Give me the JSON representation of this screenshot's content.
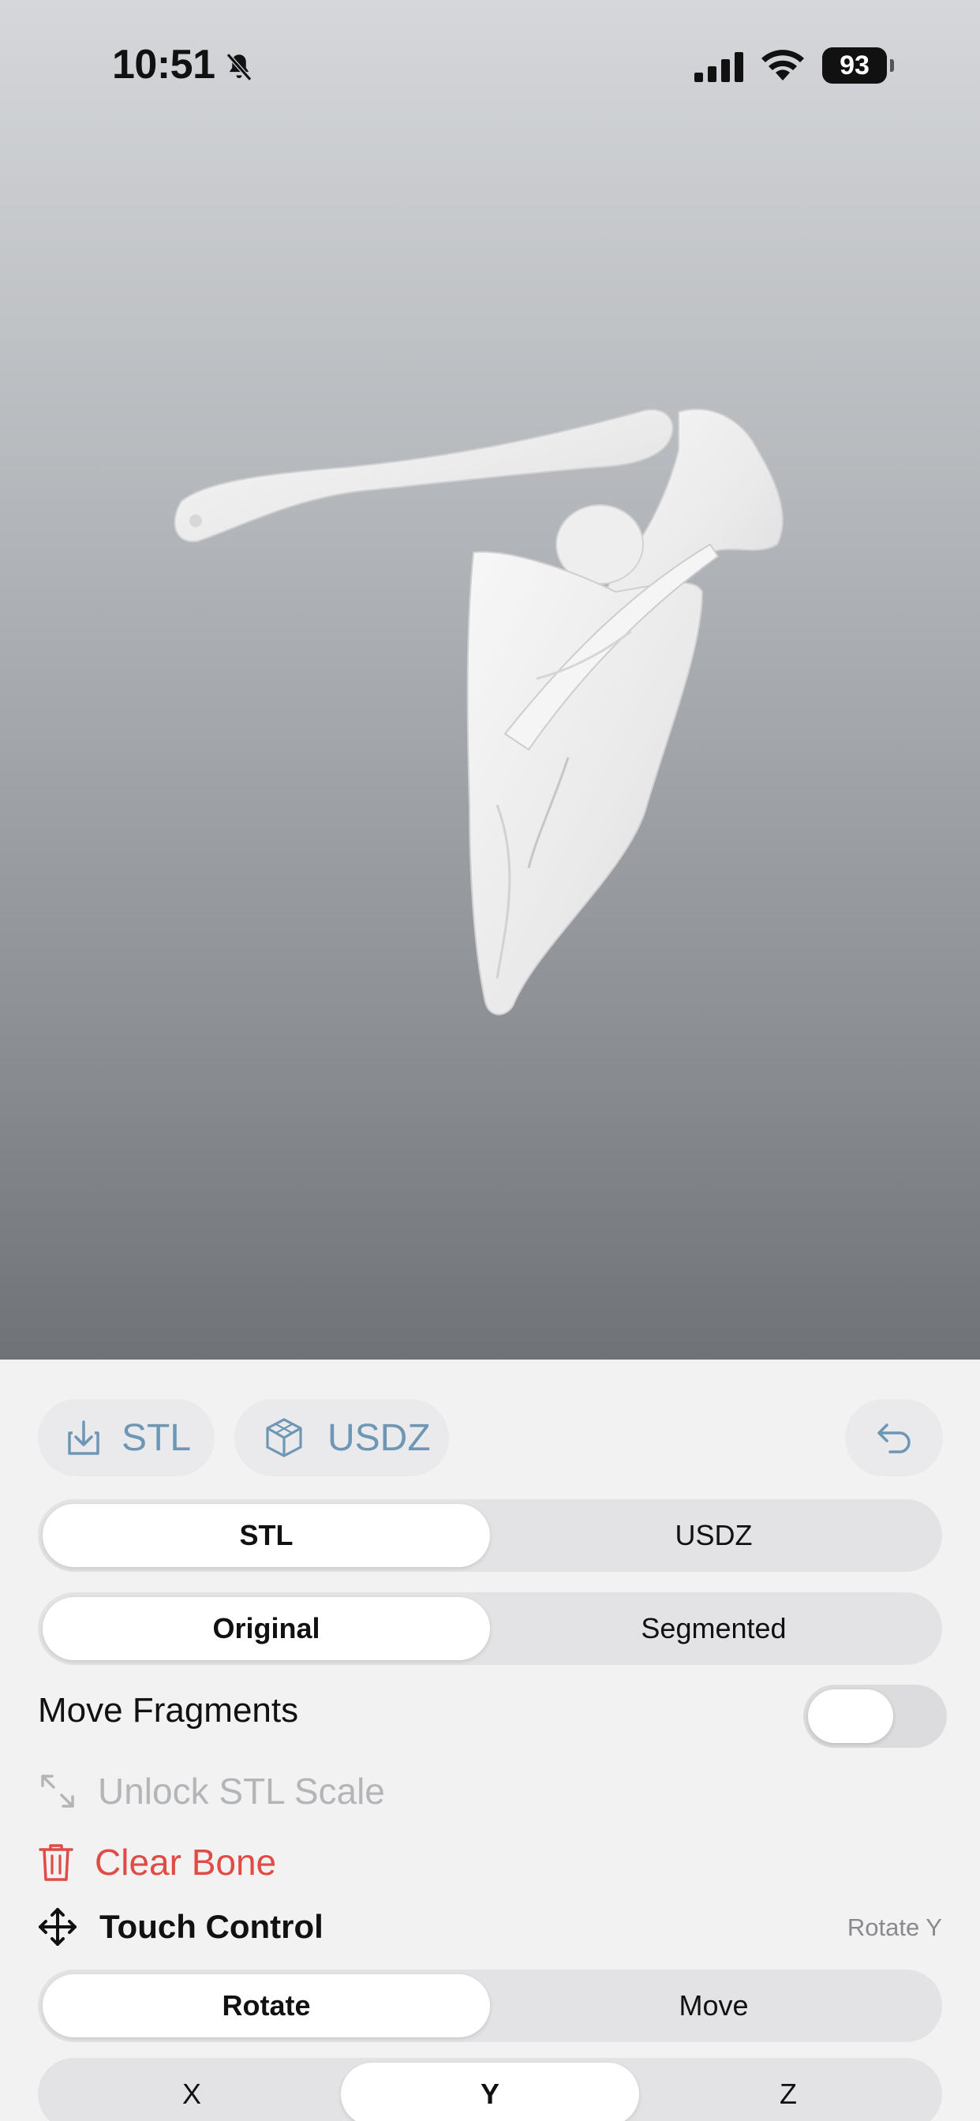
{
  "status_bar": {
    "time": "10:51",
    "battery": "93",
    "icons": [
      "bell-slash-icon",
      "cellular-signal-icon",
      "wifi-icon",
      "battery-icon"
    ]
  },
  "viewport": {
    "model": "shoulder-bone-model",
    "background_top": "#d5d7da",
    "background_bottom": "#6f7277"
  },
  "export_buttons": {
    "stl_label": "STL",
    "usdz_label": "USDZ",
    "icons": [
      "download-icon",
      "cube-icon",
      "undo-icon"
    ],
    "accent": "#6e97b5"
  },
  "format_segment": {
    "options": [
      "STL",
      "USDZ"
    ],
    "selected": "STL"
  },
  "mode_segment": {
    "options": [
      "Original",
      "Segmented"
    ],
    "selected": "Original"
  },
  "move_fragments": {
    "label": "Move Fragments",
    "enabled": false
  },
  "unlock_scale": {
    "label": "Unlock STL Scale",
    "icon": "expand-arrows-icon"
  },
  "clear_bone": {
    "label": "Clear Bone",
    "icon": "trash-icon",
    "color": "#e04b45"
  },
  "touch_control": {
    "label": "Touch Control",
    "status": "Rotate Y",
    "icon": "move-arrows-icon"
  },
  "touch_segment": {
    "options": [
      "Rotate",
      "Move"
    ],
    "selected": "Rotate"
  },
  "axis_segment": {
    "options": [
      "X",
      "Y",
      "Z"
    ],
    "selected": "Y"
  }
}
